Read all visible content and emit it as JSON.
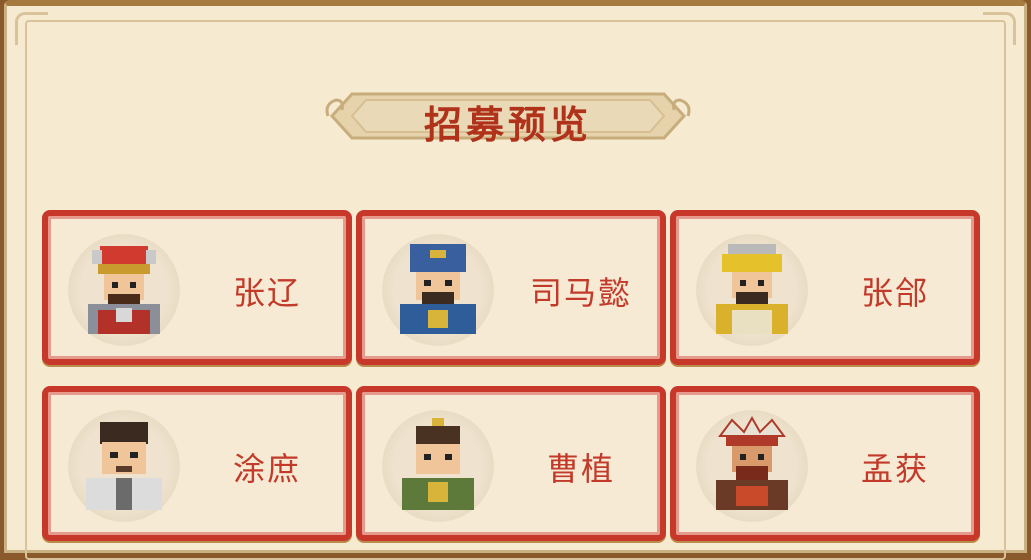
{
  "dialog": {
    "title": "招募预览"
  },
  "heroes": [
    {
      "name": "张辽",
      "icon": "zhang-liao-portrait-icon"
    },
    {
      "name": "司马懿",
      "icon": "sima-yi-portrait-icon"
    },
    {
      "name": "张郃",
      "icon": "zhang-he-portrait-icon"
    },
    {
      "name": "涂庶",
      "icon": "xu-shu-portrait-icon"
    },
    {
      "name": "曹植",
      "icon": "cao-zhi-portrait-icon"
    },
    {
      "name": "孟获",
      "icon": "meng-huo-portrait-icon"
    }
  ],
  "colors": {
    "panel": "#f6ead0",
    "card_border": "#c7382b",
    "name_text": "#c23a2a",
    "title_text": "#b0321b"
  }
}
